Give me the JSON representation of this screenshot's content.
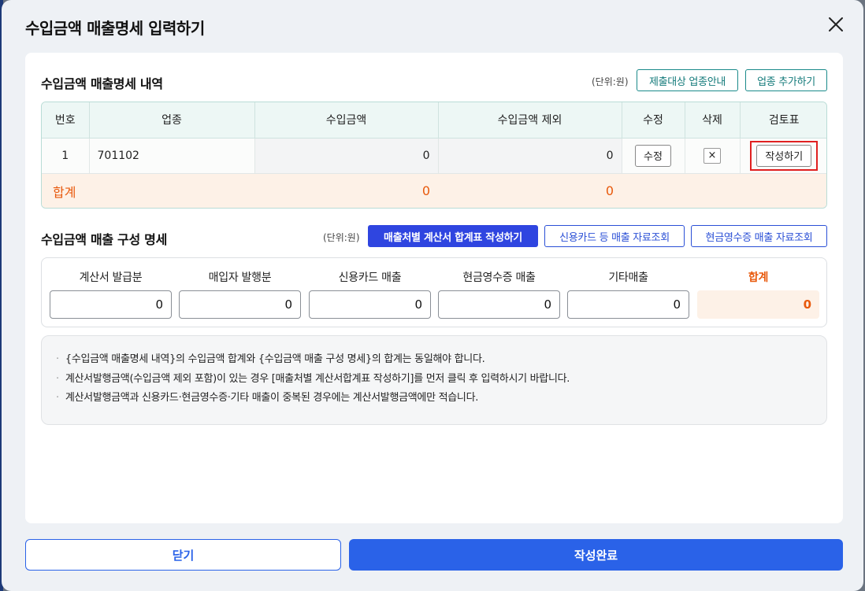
{
  "modal": {
    "title": "수입금액 매출명세 입력하기"
  },
  "detail": {
    "title": "수입금액 매출명세 내역",
    "unit": "(단위:원)",
    "btn_guide": "제출대상 업종안내",
    "btn_add": "업종 추가하기",
    "columns": [
      "번호",
      "업종",
      "수입금액",
      "수입금액 제외",
      "수정",
      "삭제",
      "검토표"
    ],
    "rows": [
      {
        "no": "1",
        "industry": "701102",
        "income": "0",
        "excluded": "0",
        "edit": "수정",
        "delete": "×",
        "review": "작성하기"
      }
    ],
    "total": {
      "label": "합계",
      "income": "0",
      "excluded": "0"
    }
  },
  "composition": {
    "title": "수입금액 매출 구성 명세",
    "unit": "(단위:원)",
    "btn_summary": "매출처별 계산서 합계표 작성하기",
    "btn_card": "신용카드 등 매출 자료조회",
    "btn_cash": "현금영수증 매출 자료조회",
    "fields": [
      {
        "label": "계산서 발급분",
        "value": "0"
      },
      {
        "label": "매입자 발행분",
        "value": "0"
      },
      {
        "label": "신용카드 매출",
        "value": "0"
      },
      {
        "label": "현금영수증 매출",
        "value": "0"
      },
      {
        "label": "기타매출",
        "value": "0"
      }
    ],
    "total": {
      "label": "합계",
      "value": "0"
    }
  },
  "notes": [
    "{수입금액 매출명세 내역}의 수입금액 합계와 {수입금액 매출 구성 명세}의 합계는 동일해야 합니다.",
    "계산서발행금액(수입금액 제외 포함)이 있는 경우 [매출처별 계산서합계표 작성하기]를 먼저 클릭 후 입력하시기 바랍니다.",
    "계산서발행금액과 신용카드·현금영수증·기타 매출이 중복된 경우에는 계산서발행금액에만 적습니다."
  ],
  "footer": {
    "close": "닫기",
    "done": "작성완료"
  },
  "colors": {
    "primary": "#2a62e8",
    "teal": "#137a7a",
    "total_orange": "#e8590c",
    "highlight_red": "#e02020"
  }
}
